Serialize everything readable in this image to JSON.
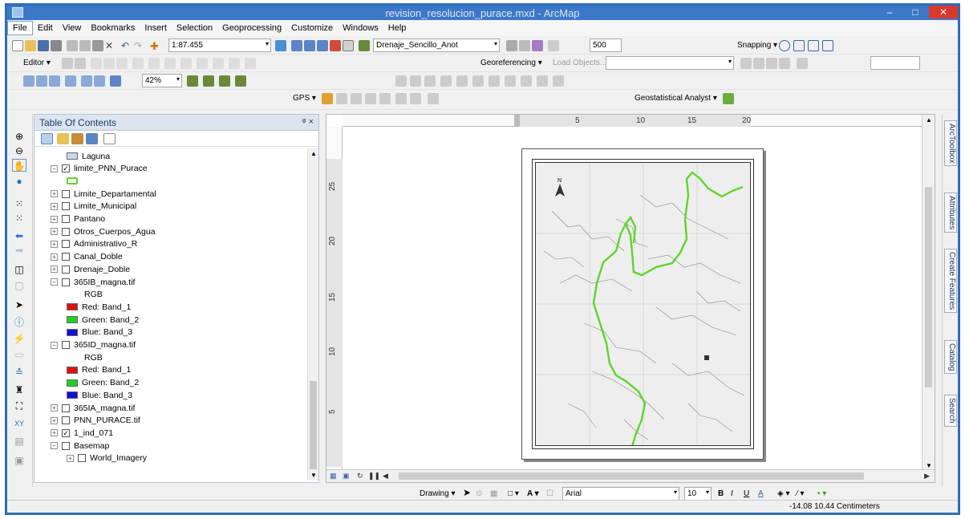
{
  "window": {
    "title": "revision_resolucion_purace.mxd - ArcMap",
    "min": "–",
    "max": "□",
    "close": "✕"
  },
  "menu": [
    "File",
    "Edit",
    "View",
    "Bookmarks",
    "Insert",
    "Selection",
    "Geoprocessing",
    "Customize",
    "Windows",
    "Help"
  ],
  "toolbar1": {
    "scale": "1:87.455",
    "layer": "Drenaje_Sencillo_Anot",
    "zoom_value": "500",
    "snapping_label": "Snapping ▾"
  },
  "toolbar2": {
    "editor_label": "Editor ▾",
    "georef_label": "Georeferencing ▾",
    "layer_placeholder": "Load Objects..."
  },
  "toolbar3": {
    "zoom_percent": "42%"
  },
  "toolbar4": {
    "gps_label": "GPS ▾",
    "geostat_label": "Geostatistical Analyst ▾"
  },
  "toc": {
    "title": "Table Of Contents",
    "pin": "ᵠ ×",
    "items": [
      {
        "label": "Laguna",
        "level": 2,
        "expander": "",
        "checkbox": "",
        "swatch": "#c8daf0"
      },
      {
        "label": "limite_PNN_Purace",
        "level": 1,
        "expander": "−",
        "checkbox": "✓"
      },
      {
        "label": "",
        "level": 2,
        "expander": "",
        "checkbox": "",
        "swatch": "green-outline"
      },
      {
        "label": "Limite_Departamental",
        "level": 1,
        "expander": "+",
        "checkbox": " "
      },
      {
        "label": "Limite_Municipal",
        "level": 1,
        "expander": "+",
        "checkbox": " "
      },
      {
        "label": "Pantano",
        "level": 1,
        "expander": "+",
        "checkbox": " "
      },
      {
        "label": "Otros_Cuerpos_Agua",
        "level": 1,
        "expander": "+",
        "checkbox": " "
      },
      {
        "label": "Administrativo_R",
        "level": 1,
        "expander": "+",
        "checkbox": " "
      },
      {
        "label": "Canal_Doble",
        "level": 1,
        "expander": "+",
        "checkbox": " "
      },
      {
        "label": "Drenaje_Doble",
        "level": 1,
        "expander": "+",
        "checkbox": " "
      },
      {
        "label": "365IB_magna.tif",
        "level": 1,
        "expander": "−",
        "checkbox": " "
      },
      {
        "label": "RGB",
        "level": 3,
        "expander": "",
        "checkbox": ""
      },
      {
        "label": "Red:   Band_1",
        "level": 2,
        "expander": "",
        "checkbox": "",
        "swatch": "#e01010"
      },
      {
        "label": "Green: Band_2",
        "level": 2,
        "expander": "",
        "checkbox": "",
        "swatch": "#22d022"
      },
      {
        "label": "Blue:  Band_3",
        "level": 2,
        "expander": "",
        "checkbox": "",
        "swatch": "#1010d8"
      },
      {
        "label": "365ID_magna.tif",
        "level": 1,
        "expander": "−",
        "checkbox": " "
      },
      {
        "label": "RGB",
        "level": 3,
        "expander": "",
        "checkbox": ""
      },
      {
        "label": "Red:   Band_1",
        "level": 2,
        "expander": "",
        "checkbox": "",
        "swatch": "#e01010"
      },
      {
        "label": "Green: Band_2",
        "level": 2,
        "expander": "",
        "checkbox": "",
        "swatch": "#22d022"
      },
      {
        "label": "Blue:  Band_3",
        "level": 2,
        "expander": "",
        "checkbox": "",
        "swatch": "#1010d8"
      },
      {
        "label": "365IA_magna.tif",
        "level": 1,
        "expander": "+",
        "checkbox": " "
      },
      {
        "label": "PNN_PURACE.tif",
        "level": 1,
        "expander": "+",
        "checkbox": " "
      },
      {
        "label": "1_ind_071",
        "level": 1,
        "expander": "+",
        "checkbox": "✓"
      },
      {
        "label": "Basemap",
        "level": 1,
        "expander": "−",
        "checkbox": " "
      },
      {
        "label": "World_Imagery",
        "level": 2,
        "expander": "+",
        "checkbox": " "
      }
    ]
  },
  "ruler": {
    "top": [
      "5",
      "10",
      "15",
      "20"
    ],
    "left": [
      "25",
      "20",
      "15",
      "10",
      "5"
    ]
  },
  "dock_tabs": [
    "ArcToolbox",
    "Attributes",
    "Create Features",
    "Catalog",
    "Search"
  ],
  "drawing": {
    "label": "Drawing ▾",
    "font": "Arial",
    "size": "10",
    "bold": "B",
    "italic": "I",
    "underline": "U",
    "textA": "A"
  },
  "status": {
    "coords": "-14.08  10.44 Centimeters"
  },
  "map": {
    "north": "N"
  },
  "colors": {
    "accent": "#3b78c8",
    "boundary": "#5fd42a"
  }
}
